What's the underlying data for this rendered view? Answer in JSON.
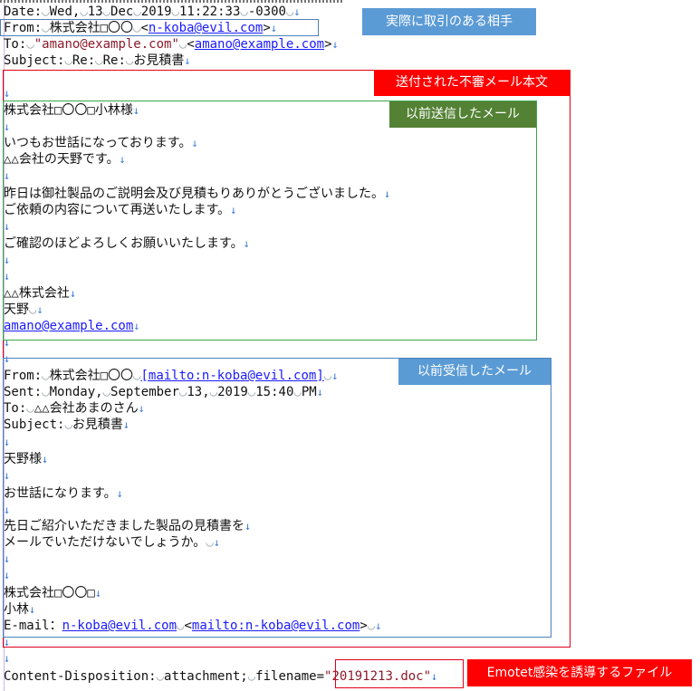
{
  "headers": {
    "date": {
      "label": "Date:",
      "a": "Wed,",
      "b": "13",
      "c": "Dec",
      "d": "2019",
      "e": "11:22:33",
      "f": "-0300"
    },
    "from": {
      "label": "From:",
      "company": "株式会社□〇〇",
      "lt": "<",
      "email": "n-koba@evil.com",
      "gt": ">"
    },
    "to": {
      "label": "To:",
      "name": "\"amano@example.com\"",
      "lt": "<",
      "email": "amano@example.com",
      "gt": ">"
    },
    "subject": {
      "label": "Subject:",
      "a": "Re:",
      "b": "Re:",
      "c": "お見積書"
    }
  },
  "body": {
    "addressee": "株式会社□〇〇□小林様",
    "greeting": "いつもお世話になっております。",
    "intro": "△△会社の天野です。",
    "p1a": "昨日は御社製品のご説明会及び見積もりありがとうございました。",
    "p1b": "ご依頼の内容について再送いたします。",
    "p2": "ご確認のほどよろしくお願いいたします。",
    "sig_company": "△△株式会社",
    "sig_name": "天野",
    "sig_email": "amano@example.com"
  },
  "quoted": {
    "from_label": "From:",
    "from_company": "株式会社□〇〇",
    "from_mailto": "[mailto:n-koba@evil.com]",
    "sent_label": "Sent:",
    "sent_a": "Monday,",
    "sent_b": "September",
    "sent_c": "13,",
    "sent_d": "2019",
    "sent_e": "15:40",
    "sent_f": "PM",
    "to_label": "To:",
    "to_value": "△△会社あまのさん",
    "subject_label": "Subject:",
    "subject_value": "お見積書",
    "salutation": "天野様",
    "greeting": "お世話になります。",
    "req1": "先日ご紹介いただきました製品の見積書を",
    "req2": "メールでいただけないでしょうか。",
    "sig_company": "株式会社□〇〇□",
    "sig_name": "小林",
    "sig_email_label": "E-mail：",
    "sig_email": "n-koba@evil.com",
    "sig_mailto": "mailto:n-koba@evil.com"
  },
  "attachment": {
    "label": "Content-Disposition:",
    "type": "attachment;",
    "param": "filename=",
    "filename": "\"20191213.doc\""
  },
  "annotations": {
    "actual_sender": "実際に取引のある相手",
    "suspicious_body": "送付された不審メール本文",
    "previously_sent": "以前送信したメール",
    "previously_received": "以前受信したメール",
    "emotet_file": "Emotet感染を誘導するファイル"
  },
  "glyphs": {
    "nl": "↓",
    "sp": "◡"
  },
  "colors": {
    "blue_tag": "#5b9bd5",
    "red_tag": "#ff0000",
    "green_tag": "#548235",
    "blue_frame": "#4f81bd",
    "red_frame": "#e0001b",
    "green_frame": "#3aa64a"
  }
}
